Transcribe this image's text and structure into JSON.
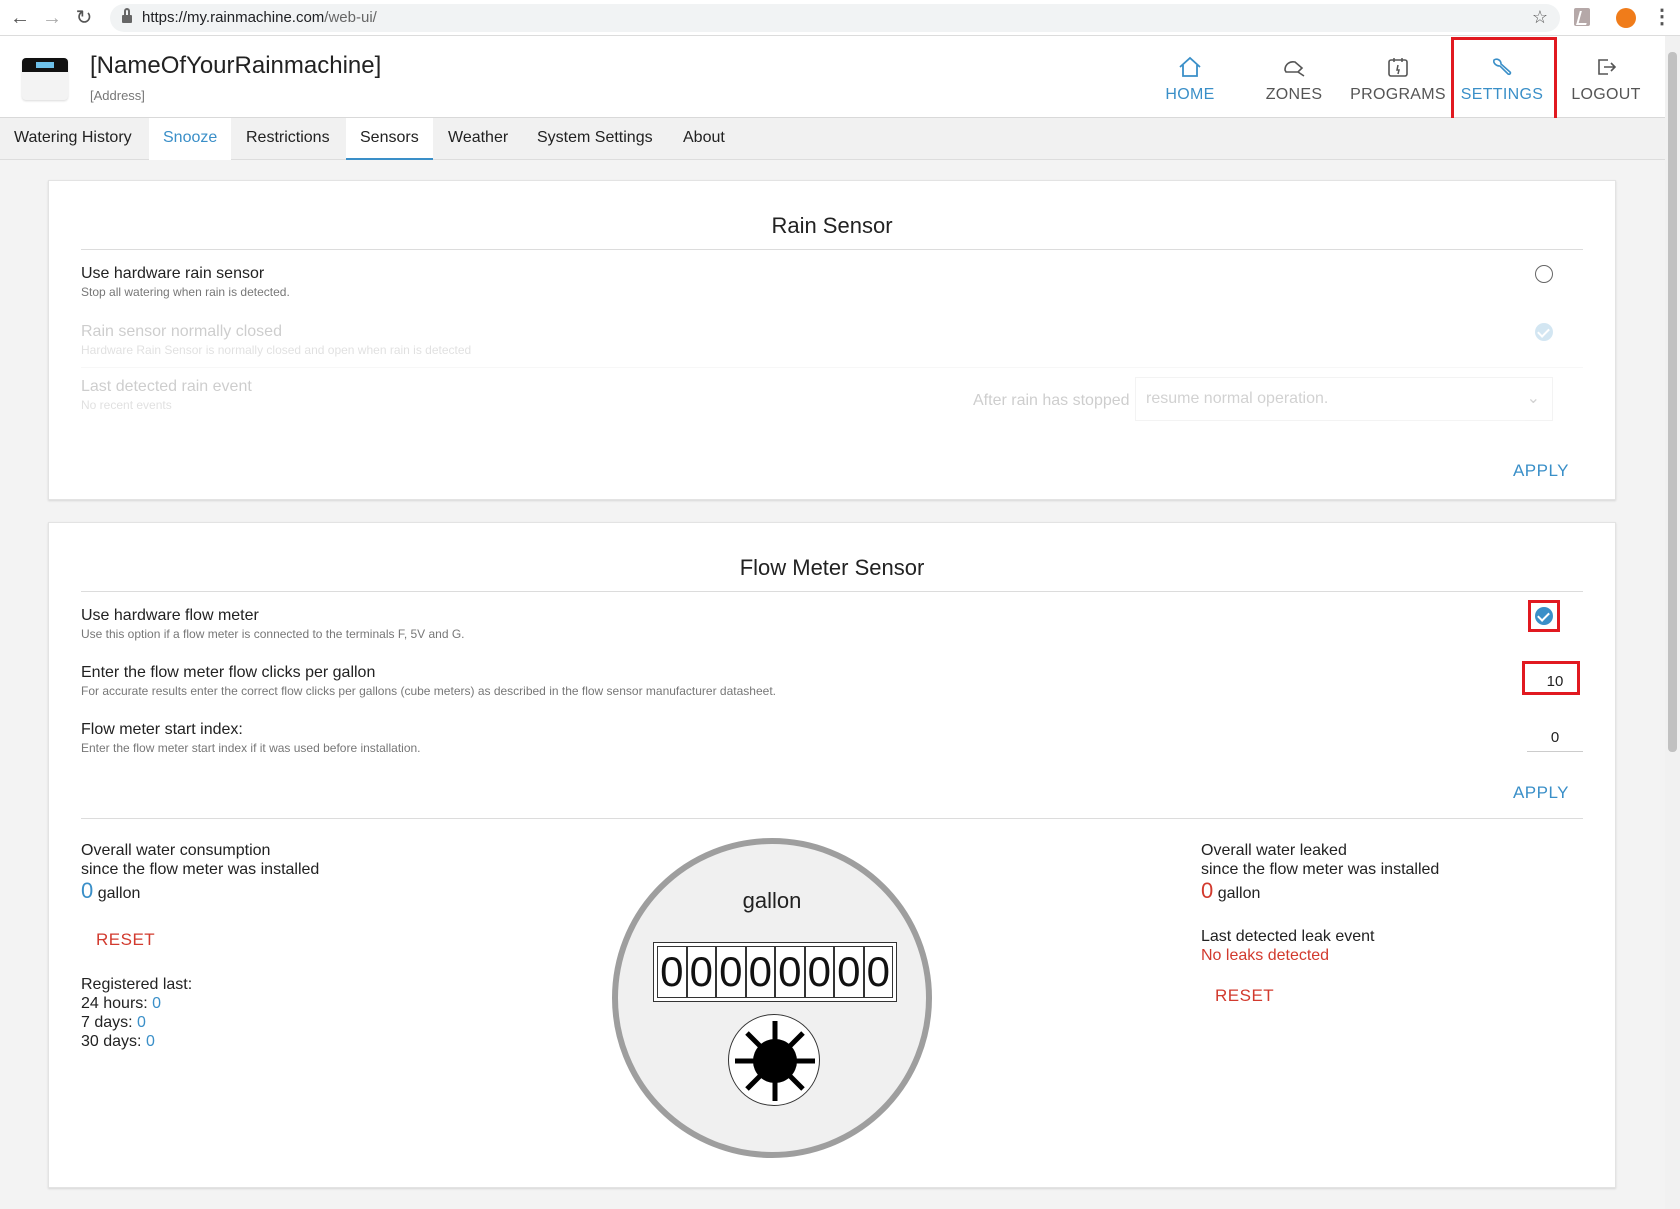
{
  "browser": {
    "url_host": "https://my.rainmachine.com",
    "url_path": "/web-ui/"
  },
  "app": {
    "device_name": "[NameOfYourRainmachine]",
    "device_address": "[Address]"
  },
  "topnav": [
    {
      "label": "HOME",
      "icon": "home-icon"
    },
    {
      "label": "ZONES",
      "icon": "sprinkler-icon"
    },
    {
      "label": "PROGRAMS",
      "icon": "calendar-icon"
    },
    {
      "label": "SETTINGS",
      "icon": "wrench-icon",
      "active": true
    },
    {
      "label": "LOGOUT",
      "icon": "logout-icon"
    }
  ],
  "subtabs": [
    "Watering History",
    "Snooze",
    "Restrictions",
    "Sensors",
    "Weather",
    "System Settings",
    "About"
  ],
  "rain_sensor": {
    "title": "Rain Sensor",
    "use_hw_title": "Use hardware rain sensor",
    "use_hw_desc": "Stop all watering when rain is detected.",
    "normally_closed_title": "Rain sensor normally closed",
    "normally_closed_desc": "Hardware Rain Sensor is normally closed and open when rain is detected",
    "last_event_title": "Last detected rain event",
    "last_event_desc": "No recent events",
    "after_rain_label": "After rain has stopped",
    "after_rain_value": "resume normal operation.",
    "apply": "APPLY"
  },
  "flow_meter": {
    "title": "Flow Meter Sensor",
    "use_hw_title": "Use hardware flow meter",
    "use_hw_desc": "Use this option if a flow meter is connected to the terminals F, 5V and G.",
    "use_hw_checked": true,
    "clicks_title": "Enter the flow meter flow clicks per gallon",
    "clicks_desc": "For accurate results enter the correct flow clicks per gallons (cube meters) as described in the flow sensor manufacturer datasheet.",
    "clicks_value": "10",
    "start_title": "Flow meter start index:",
    "start_desc": "Enter the flow meter start index if it was used before installation.",
    "start_value": "0",
    "apply": "APPLY",
    "consumption_line1": "Overall water consumption",
    "consumption_line2": "since the flow meter was installed",
    "consumption_value": "0",
    "unit": "gallon",
    "reset": "RESET",
    "registered_title": "Registered last:",
    "registered": [
      {
        "label": "24 hours:",
        "value": "0"
      },
      {
        "label": "7 days:",
        "value": "0"
      },
      {
        "label": "30 days:",
        "value": "0"
      }
    ],
    "meter_unit": "gallon",
    "meter_digits": [
      "0",
      "0",
      "0",
      "0",
      "0",
      "0",
      "0",
      "0"
    ],
    "leaked_line1": "Overall water leaked",
    "leaked_line2": "since the flow meter was installed",
    "leaked_value": "0",
    "leak_event_title": "Last detected leak event",
    "leak_event_value": "No leaks detected",
    "reset2": "RESET"
  },
  "colors": {
    "accent": "#3a8fc8",
    "danger": "#d23a2e",
    "highlight": "#e11920"
  }
}
